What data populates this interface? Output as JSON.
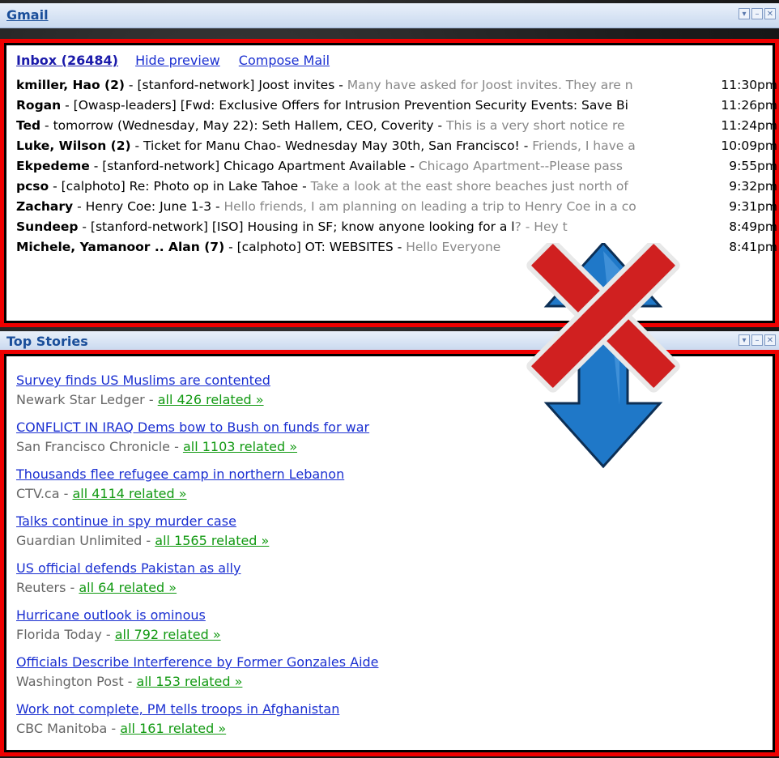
{
  "gmail": {
    "title": "Gmail",
    "inbox_label": "Inbox (26484)",
    "hide_preview": "Hide preview",
    "compose": "Compose Mail",
    "separator": " - ",
    "messages": [
      {
        "from": "kmiller, Hao (2)",
        "subject": "[stanford-network] Joost invites",
        "snippet": "Many have asked for Joost invites. They are n",
        "time": "11:30pm"
      },
      {
        "from": "Rogan",
        "subject": "[Owasp-leaders] [Fwd: Exclusive Offers for Intrusion Prevention Security Events: Save Bi",
        "snippet": "",
        "time": "11:26pm"
      },
      {
        "from": "Ted",
        "subject": "tomorrow (Wednesday, May 22): Seth Hallem, CEO, Coverity",
        "snippet": "This is a very short notice re",
        "time": "11:24pm"
      },
      {
        "from": "Luke, Wilson (2)",
        "subject": "Ticket for Manu Chao- Wednesday May 30th, San Francisco!",
        "snippet": "Friends, I have a",
        "time": "10:09pm"
      },
      {
        "from": "Ekpedeme",
        "subject": "[stanford-network] Chicago Apartment Available",
        "snippet": "Chicago Apartment--Please pass",
        "time": "9:55pm"
      },
      {
        "from": "pcso",
        "subject": "[calphoto] Re: Photo op in Lake Tahoe",
        "snippet": "Take a look at the east shore beaches just north of",
        "time": "9:32pm"
      },
      {
        "from": "Zachary",
        "subject": "Henry Coe: June 1-3",
        "snippet": "Hello friends, I am planning on leading a trip to Henry Coe in a co",
        "time": "9:31pm"
      },
      {
        "from": "Sundeep",
        "subject": "[stanford-network] [ISO] Housing in SF; know anyone looking for a l",
        "snippet": "? - Hey t",
        "time": "8:49pm"
      },
      {
        "from": "Michele, Yamanoor .. Alan (7)",
        "subject": "[calphoto] OT: WEBSITES",
        "snippet": "Hello Everyone",
        "time": "8:41pm"
      }
    ]
  },
  "news": {
    "title": "Top Stories",
    "separator": " - ",
    "stories": [
      {
        "headline": "Survey finds US Muslims are contented",
        "source": "Newark Star Ledger",
        "related": "all 426 related »"
      },
      {
        "headline": "CONFLICT IN IRAQ Dems bow to Bush on funds for war",
        "source": "San Francisco Chronicle",
        "related": "all 1103 related »"
      },
      {
        "headline": "Thousands flee refugee camp in northern Lebanon",
        "source": "CTV.ca",
        "related": "all 4114 related »"
      },
      {
        "headline": "Talks continue in spy murder case",
        "source": "Guardian Unlimited",
        "related": "all 1565 related »"
      },
      {
        "headline": "US official defends Pakistan as ally",
        "source": "Reuters",
        "related": "all 64 related »"
      },
      {
        "headline": "Hurricane outlook is ominous",
        "source": "Florida Today",
        "related": "all 792 related »"
      },
      {
        "headline": "Officials Describe Interference by Former Gonzales Aide",
        "source": "Washington Post",
        "related": "all 153 related »"
      },
      {
        "headline": "Work not complete, PM tells troops in Afghanistan",
        "source": "CBC Manitoba",
        "related": "all 161 related »"
      }
    ]
  },
  "gadget_controls": {
    "menu_icon": "chevron-down-icon",
    "minimize_icon": "minimize-icon",
    "close_icon": "close-icon"
  },
  "colors": {
    "highlight_border": "#ee0000",
    "link": "#1a2fd1",
    "related": "#119911",
    "arrow": "#1f78c8",
    "cross": "#d02020"
  }
}
